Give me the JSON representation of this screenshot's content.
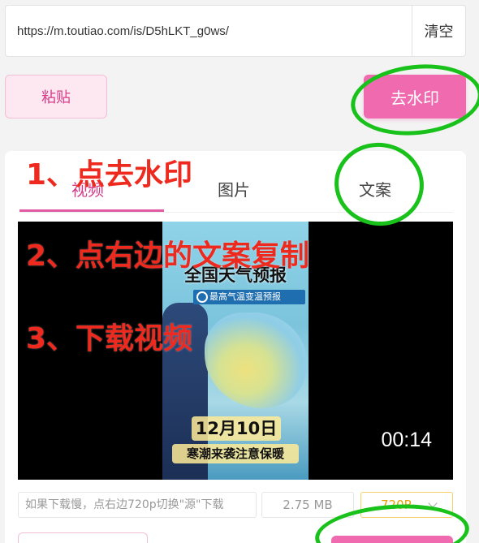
{
  "url_bar": {
    "value": "https://m.toutiao.com/is/D5hLKT_g0ws/",
    "clear_label": "清空"
  },
  "actions": {
    "paste_label": "粘贴",
    "remove_watermark_label": "去水印"
  },
  "tabs": [
    {
      "label": "视频",
      "active": true
    },
    {
      "label": "图片",
      "active": false
    },
    {
      "label": "文案",
      "active": false
    }
  ],
  "video": {
    "frame_title": "全国天气预报",
    "frame_banner": "最高气温变温预报",
    "frame_date": "12月10日",
    "frame_subtitle": "寒潮来袭注意保暖",
    "time": "00:14"
  },
  "info_row": {
    "tip": "如果下载慢，点右边720p切换\"源\"下载",
    "size": "2.75 MB",
    "quality": "720P"
  },
  "annotations": [
    "1、点去水印",
    "2、点右边的文案复制",
    "3、下载视频"
  ],
  "colors": {
    "accent": "#f06aaf",
    "annotation_text": "#ee2a1f",
    "annotation_circle": "#19c21a"
  },
  "icons": {
    "quality_dropdown": "chevron-down-icon"
  }
}
